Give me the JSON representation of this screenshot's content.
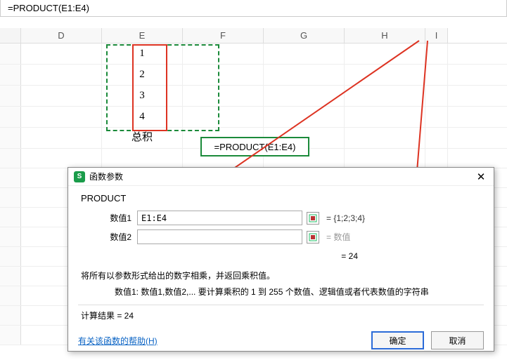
{
  "formula_bar": "=PRODUCT(E1:E4)",
  "columns": [
    "D",
    "E",
    "F",
    "G",
    "H",
    "I"
  ],
  "data_cells": {
    "e1": "1",
    "e2": "2",
    "e3": "3",
    "e4": "4",
    "e5_label": "总积",
    "f5_formula": "=PRODUCT(E1:E4)"
  },
  "dialog": {
    "title": "函数参数",
    "fn_name": "PRODUCT",
    "param1_label": "数值1",
    "param1_value": "E1:E4",
    "param1_result": "= {1;2;3;4}",
    "param2_label": "数值2",
    "param2_value": "",
    "param2_result": "= 数值",
    "eq_result": "= 24",
    "description": "将所有以参数形式给出的数字相乘，并返回乘积值。",
    "param_desc": "数值1:   数值1,数值2,... 要计算乘积的 1 到 255 个数值、逻辑值或者代表数值的字符串",
    "calc_label": "计算结果 =  24",
    "help_link": "有关该函数的帮助(H)",
    "ok": "确定",
    "cancel": "取消"
  },
  "chart_data": {
    "type": "table",
    "title": "PRODUCT function example",
    "range": "E1:E4",
    "values": [
      1,
      2,
      3,
      4
    ],
    "result": 24
  }
}
